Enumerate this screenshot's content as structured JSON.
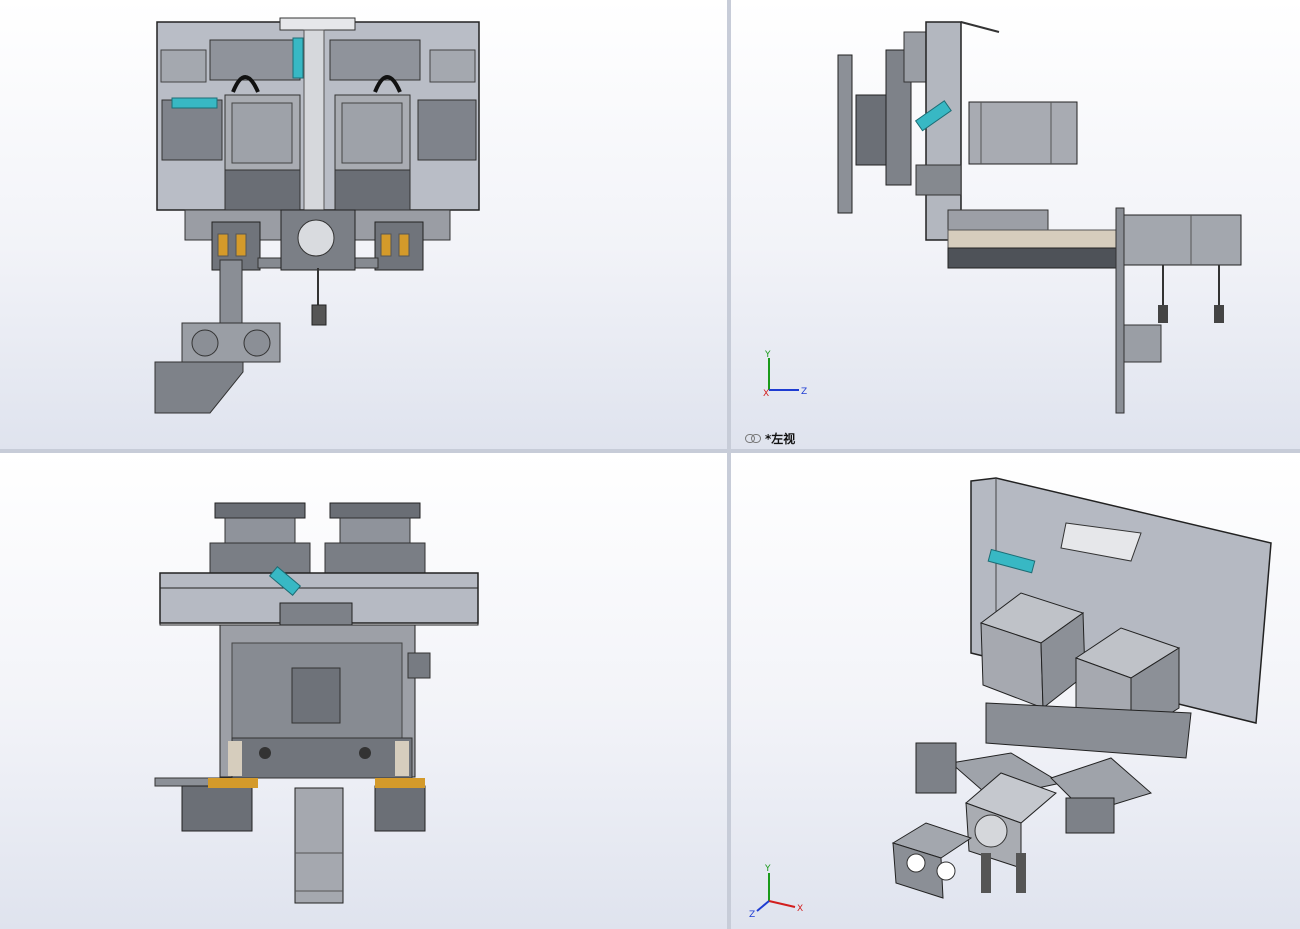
{
  "viewports": {
    "top_left": {
      "name": "front"
    },
    "top_right": {
      "name": "left",
      "label": "*左视"
    },
    "bottom_left": {
      "name": "top"
    },
    "bottom_right": {
      "name": "isometric"
    }
  },
  "triad": {
    "x": "X",
    "y": "Y",
    "z": "Z"
  },
  "colors": {
    "metal": "#8f939b",
    "metal_dark": "#5c6068",
    "metal_light": "#c5c8ce",
    "accent_cyan": "#38b8c4",
    "glass": "#b8bcc6",
    "triad_x": "#d21e1e",
    "triad_y": "#1a9a1a",
    "triad_z": "#1e3cd2"
  },
  "icons": [
    "link-icon",
    "axis-triad-icon"
  ]
}
